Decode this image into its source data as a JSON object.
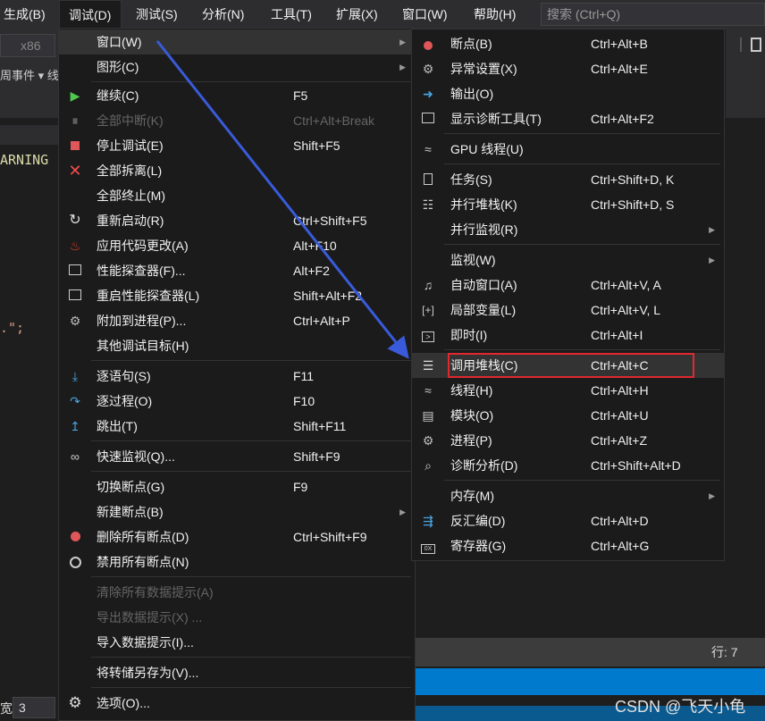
{
  "menubar": {
    "items": [
      "生成(B)",
      "调试(D)",
      "测试(S)",
      "分析(N)",
      "工具(T)",
      "扩展(X)",
      "窗口(W)",
      "帮助(H)"
    ],
    "search_placeholder": "搜索 (Ctrl+Q)"
  },
  "ide": {
    "platform": "x86",
    "lifecycle_text": "周事件 ▾ 线",
    "code_line1": "ARNING",
    "code_line2": ".\";",
    "line_info": "行: 7",
    "zoom_label": "宽:",
    "zoom_value": "3",
    "watermark": "CSDN @飞天小龟"
  },
  "debug_menu": {
    "items": [
      {
        "label": "窗口(W)",
        "shortcut": "",
        "icon": "none",
        "submenu": true,
        "disabled": false
      },
      {
        "label": "图形(C)",
        "shortcut": "",
        "icon": "none",
        "submenu": true,
        "disabled": false
      },
      {
        "label": "继续(C)",
        "shortcut": "F5",
        "icon": "continue-play-icon",
        "submenu": false,
        "disabled": false
      },
      {
        "label": "全部中断(K)",
        "shortcut": "Ctrl+Alt+Break",
        "icon": "pause-icon",
        "submenu": false,
        "disabled": true
      },
      {
        "label": "停止调试(E)",
        "shortcut": "Shift+F5",
        "icon": "stop-icon",
        "submenu": false,
        "disabled": false
      },
      {
        "label": "全部拆离(L)",
        "shortcut": "",
        "icon": "detach-x-icon",
        "submenu": false,
        "disabled": false
      },
      {
        "label": "全部终止(M)",
        "shortcut": "",
        "icon": "none",
        "submenu": false,
        "disabled": false
      },
      {
        "label": "重新启动(R)",
        "shortcut": "Ctrl+Shift+F5",
        "icon": "restart-icon",
        "submenu": false,
        "disabled": false
      },
      {
        "label": "应用代码更改(A)",
        "shortcut": "Alt+F10",
        "icon": "hot-reload-flame-icon",
        "submenu": false,
        "disabled": false
      },
      {
        "label": "性能探查器(F)...",
        "shortcut": "Alt+F2",
        "icon": "profiler-icon",
        "submenu": false,
        "disabled": false
      },
      {
        "label": "重启性能探查器(L)",
        "shortcut": "Shift+Alt+F2",
        "icon": "profiler-restart-icon",
        "submenu": false,
        "disabled": false
      },
      {
        "label": "附加到进程(P)...",
        "shortcut": "Ctrl+Alt+P",
        "icon": "attach-gears-icon",
        "submenu": false,
        "disabled": false
      },
      {
        "label": "其他调试目标(H)",
        "shortcut": "",
        "icon": "none",
        "submenu": true,
        "disabled": false
      },
      {
        "label": "逐语句(S)",
        "shortcut": "F11",
        "icon": "step-into-icon",
        "submenu": false,
        "disabled": false
      },
      {
        "label": "逐过程(O)",
        "shortcut": "F10",
        "icon": "step-over-icon",
        "submenu": false,
        "disabled": false
      },
      {
        "label": "跳出(T)",
        "shortcut": "Shift+F11",
        "icon": "step-out-icon",
        "submenu": false,
        "disabled": false
      },
      {
        "label": "快速监视(Q)...",
        "shortcut": "Shift+F9",
        "icon": "quick-watch-glasses-icon",
        "submenu": false,
        "disabled": false
      },
      {
        "label": "切换断点(G)",
        "shortcut": "F9",
        "icon": "none",
        "submenu": false,
        "disabled": false
      },
      {
        "label": "新建断点(B)",
        "shortcut": "",
        "icon": "none",
        "submenu": true,
        "disabled": false
      },
      {
        "label": "删除所有断点(D)",
        "shortcut": "Ctrl+Shift+F9",
        "icon": "delete-breakpoints-icon",
        "submenu": false,
        "disabled": false
      },
      {
        "label": "禁用所有断点(N)",
        "shortcut": "",
        "icon": "disable-breakpoints-icon",
        "submenu": false,
        "disabled": false
      },
      {
        "label": "清除所有数据提示(A)",
        "shortcut": "",
        "icon": "none",
        "submenu": false,
        "disabled": true
      },
      {
        "label": "导出数据提示(X) ...",
        "shortcut": "",
        "icon": "none",
        "submenu": false,
        "disabled": true
      },
      {
        "label": "导入数据提示(I)...",
        "shortcut": "",
        "icon": "none",
        "submenu": false,
        "disabled": false
      },
      {
        "label": "将转储另存为(V)...",
        "shortcut": "",
        "icon": "none",
        "submenu": false,
        "disabled": false
      },
      {
        "label": "选项(O)...",
        "shortcut": "",
        "icon": "options-gear-icon",
        "submenu": false,
        "disabled": false
      }
    ]
  },
  "window_menu": {
    "items": [
      {
        "label": "断点(B)",
        "shortcut": "Ctrl+Alt+B",
        "icon": "breakpoints-icon",
        "submenu": false
      },
      {
        "label": "异常设置(X)",
        "shortcut": "Ctrl+Alt+E",
        "icon": "exception-settings-icon",
        "submenu": false
      },
      {
        "label": "输出(O)",
        "shortcut": "",
        "icon": "output-icon",
        "submenu": false
      },
      {
        "label": "显示诊断工具(T)",
        "shortcut": "Ctrl+Alt+F2",
        "icon": "diagnostic-tools-icon",
        "submenu": false
      },
      {
        "label": "GPU 线程(U)",
        "shortcut": "",
        "icon": "gpu-threads-icon",
        "submenu": false
      },
      {
        "label": "任务(S)",
        "shortcut": "Ctrl+Shift+D, K",
        "icon": "tasks-clipboard-icon",
        "submenu": false
      },
      {
        "label": "并行堆栈(K)",
        "shortcut": "Ctrl+Shift+D, S",
        "icon": "parallel-stacks-icon",
        "submenu": false
      },
      {
        "label": "并行监视(R)",
        "shortcut": "",
        "icon": "none",
        "submenu": true
      },
      {
        "label": "监视(W)",
        "shortcut": "",
        "icon": "none",
        "submenu": true
      },
      {
        "label": "自动窗口(A)",
        "shortcut": "Ctrl+Alt+V, A",
        "icon": "autos-icon",
        "submenu": false
      },
      {
        "label": "局部变量(L)",
        "shortcut": "Ctrl+Alt+V, L",
        "icon": "locals-icon",
        "submenu": false
      },
      {
        "label": "即时(I)",
        "shortcut": "Ctrl+Alt+I",
        "icon": "immediate-icon",
        "submenu": false
      },
      {
        "label": "调用堆栈(C)",
        "shortcut": "Ctrl+Alt+C",
        "icon": "call-stack-icon",
        "submenu": false
      },
      {
        "label": "线程(H)",
        "shortcut": "Ctrl+Alt+H",
        "icon": "threads-icon",
        "submenu": false
      },
      {
        "label": "模块(O)",
        "shortcut": "Ctrl+Alt+U",
        "icon": "modules-icon",
        "submenu": false
      },
      {
        "label": "进程(P)",
        "shortcut": "Ctrl+Alt+Z",
        "icon": "processes-gears-icon",
        "submenu": false
      },
      {
        "label": "诊断分析(D)",
        "shortcut": "Ctrl+Shift+Alt+D",
        "icon": "diagnostic-analysis-icon",
        "submenu": false
      },
      {
        "label": "内存(M)",
        "shortcut": "",
        "icon": "none",
        "submenu": true
      },
      {
        "label": "反汇编(D)",
        "shortcut": "Ctrl+Alt+D",
        "icon": "disassembly-icon",
        "submenu": false
      },
      {
        "label": "寄存器(G)",
        "shortcut": "Ctrl+Alt+G",
        "icon": "registers-icon",
        "submenu": false
      }
    ]
  },
  "colors": {
    "highlight_box": "#e0282e",
    "arrow": "#3a5bd9",
    "status_blue": "#007acc"
  }
}
